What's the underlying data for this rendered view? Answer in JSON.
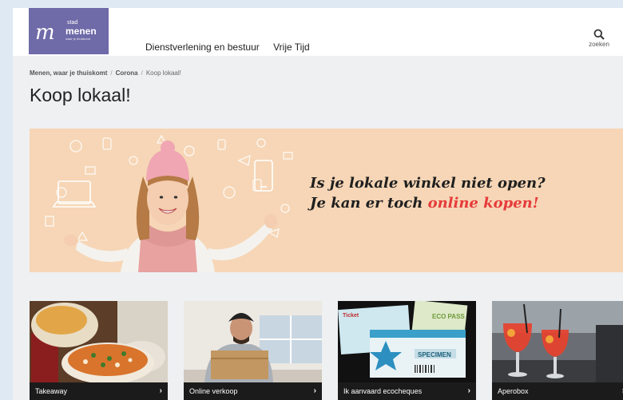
{
  "header": {
    "logo": {
      "mark": "m",
      "line1": "stad",
      "line2": "menen",
      "tagline": "waar je thuiskomt"
    },
    "nav": [
      "Dienstverlening en bestuur",
      "Vrije Tijd"
    ],
    "search_label": "zoeken"
  },
  "breadcrumb": [
    "Menen, waar je thuiskomt",
    "Corona",
    "Koop lokaal!"
  ],
  "breadcrumb_separator": "/",
  "page_title": "Koop lokaal!",
  "banner": {
    "line1": "Is je lokale winkel niet open?",
    "line2_prefix": "Je kan er toch ",
    "line2_highlight": "online kopen!"
  },
  "cards": [
    {
      "label": "Takeaway",
      "arrow": "›"
    },
    {
      "label": "Online verkoop",
      "arrow": "›"
    },
    {
      "label": "Ik aanvaard ecocheques",
      "arrow": "›"
    },
    {
      "label": "Aperobox",
      "arrow": "›"
    }
  ],
  "ecocheque_image_text": {
    "top": "Ticket",
    "mid": "SPECIMEN",
    "side": "ECO PASS"
  },
  "colors": {
    "brand": "#6f6aa8",
    "banner_bg": "#f6d6b6",
    "highlight": "#e63b3b",
    "card_bar": "#1b1b1b"
  },
  "icons": {
    "search": "search-icon",
    "chevron": "chevron-right-icon"
  }
}
